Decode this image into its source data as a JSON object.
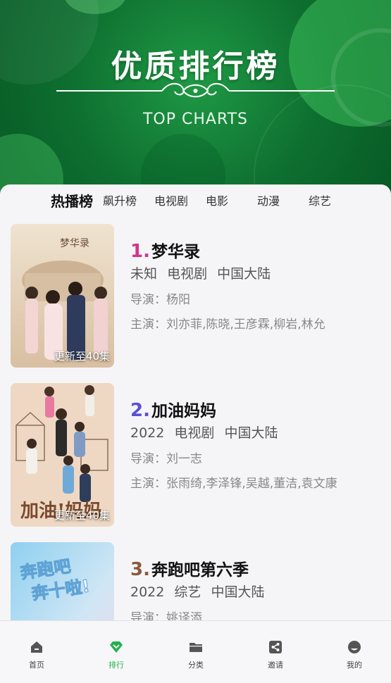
{
  "hero": {
    "title": "优质排行榜",
    "subtitle": "TOP CHARTS"
  },
  "colors": {
    "accent": "#22b14c",
    "rank1": "#d6338a",
    "rank2": "#5a4fd6",
    "rank3": "#8a5a3a"
  },
  "tabs": [
    {
      "label": "热播榜",
      "active": true
    },
    {
      "label": "飙升榜",
      "active": false
    },
    {
      "label": "电视剧",
      "active": false
    },
    {
      "label": "电影",
      "active": false
    },
    {
      "label": "动漫",
      "active": false
    },
    {
      "label": "综艺",
      "active": false
    }
  ],
  "items": [
    {
      "rank": "1.",
      "title": "梦华录",
      "year": "未知",
      "type": "电视剧",
      "region": "中国大陆",
      "director": "导演：杨阳",
      "cast": "主演：刘亦菲,陈晓,王彦霖,柳岩,林允",
      "badge": "更新至40集",
      "poster_text": "梦华录"
    },
    {
      "rank": "2.",
      "title": "加油妈妈",
      "year": "2022",
      "type": "电视剧",
      "region": "中国大陆",
      "director": "导演：刘一志",
      "cast": "主演：张雨绮,李泽锋,吴越,董洁,袁文康",
      "badge": "更新至40集",
      "poster_text": "加油!妈妈"
    },
    {
      "rank": "3.",
      "title": "奔跑吧第六季",
      "year": "2022",
      "type": "综艺",
      "region": "中国大陆",
      "director": "导演：姚译添",
      "cast": "",
      "badge": "",
      "poster_text": "奔跑吧 奔十啦!"
    }
  ],
  "bottom_nav": [
    {
      "label": "首页",
      "icon": "home-icon",
      "active": false
    },
    {
      "label": "排行",
      "icon": "rank-diamond-icon",
      "active": true
    },
    {
      "label": "分类",
      "icon": "folder-icon",
      "active": false
    },
    {
      "label": "邀请",
      "icon": "share-icon",
      "active": false
    },
    {
      "label": "我的",
      "icon": "profile-icon",
      "active": false
    }
  ]
}
